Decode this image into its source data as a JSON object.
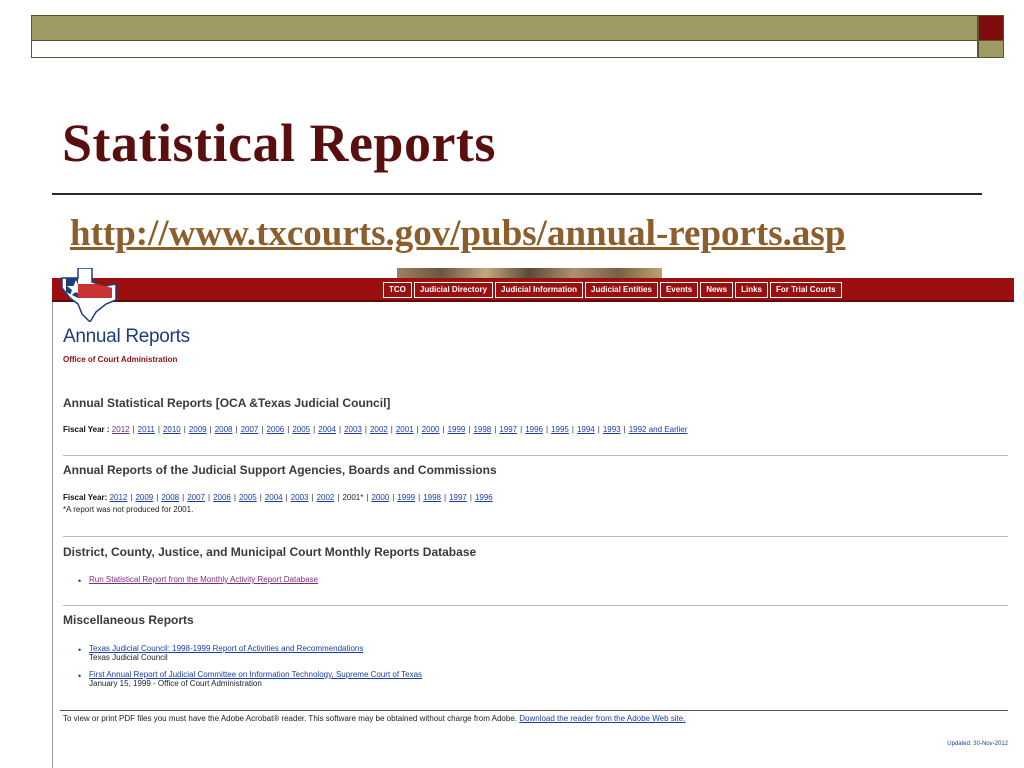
{
  "slide": {
    "title": "Statistical Reports",
    "url": "http://www.txcourts.gov/pubs/annual-reports.asp"
  },
  "site": {
    "nav": [
      "TCO",
      "Judicial Directory",
      "Judicial Information",
      "Judicial Entities",
      "Events",
      "News",
      "Links",
      "For Trial Courts"
    ],
    "page_title": "Annual Reports",
    "page_subtitle": "Office of Court Administration"
  },
  "sections": {
    "annual_statistical": {
      "heading": "Annual Statistical Reports [OCA &Texas Judicial Council]",
      "label": "Fiscal Year :",
      "years": [
        "2012",
        "2011",
        "2010",
        "2009",
        "2008",
        "2007",
        "2006",
        "2005",
        "2004",
        "2003",
        "2002",
        "2001",
        "2000",
        "1999",
        "1998",
        "1997",
        "1996",
        "1995",
        "1994",
        "1993",
        "1992 and Earlier"
      ]
    },
    "support_agencies": {
      "heading": "Annual Reports of the Judicial Support Agencies, Boards and Commissions",
      "label": "Fiscal Year:",
      "years_a": [
        "2012",
        "2009",
        "2008",
        "2007",
        "2006"
      ],
      "years_b": [
        "2004",
        "2003",
        "2002"
      ],
      "year_2005": "2005",
      "year_2001": "2001*",
      "years_c": [
        "2000",
        "1999",
        "1998",
        "1997",
        "1996"
      ],
      "note": "*A report was not produced for 2001."
    },
    "monthly": {
      "heading": "District, County, Justice, and Municipal Court Monthly Reports Database",
      "link": "Run Statistical Report from the Monthly Activity Report Database"
    },
    "misc": {
      "heading": "Miscellaneous Reports",
      "items": [
        {
          "link": "Texas Judicial Council: 1998-1999 Report of Activities and Recommendations",
          "sub": "Texas Judicial Council"
        },
        {
          "link": "First Annual Report of Judicial Committee on Information Technology, Supreme Court of Texas",
          "sub": "January 15, 1999 - Office of Court Administration"
        }
      ]
    }
  },
  "footer": {
    "pdf_text": "To view or print PDF files you must have the Adobe Acrobat® reader. This software may be obtained without charge from Adobe.",
    "pdf_link": "Download the reader from the Adobe Web site.",
    "updated": "Updated: 30-Nov-2012"
  },
  "colors": {
    "slide_title": "#5a0f0f",
    "slide_url": "#8b5e2b",
    "header_olive": "#9d9a66",
    "header_red": "#7d0c0c",
    "site_red": "#9b0f0f",
    "link_blue": "#1a3ea8"
  }
}
